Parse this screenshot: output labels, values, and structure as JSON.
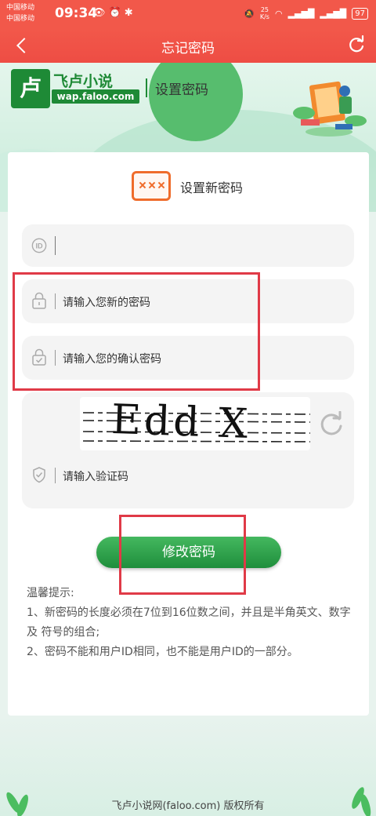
{
  "status_bar": {
    "carrier1": "中国移动",
    "carrier2": "中国移动",
    "time": "09:34",
    "net_speed_value": "25",
    "net_speed_unit": "K/s",
    "battery": "97"
  },
  "nav": {
    "title": "忘记密码"
  },
  "banner": {
    "logo_glyph": "卢",
    "logo_name": "飞卢小说",
    "logo_url": "wap.faloo.com",
    "subtitle": "设置密码"
  },
  "card": {
    "title": "设置新密码",
    "user_id_value": "",
    "new_password_placeholder": "请输入您新的密码",
    "confirm_password_placeholder": "请输入您的确认密码",
    "captcha_text": "Edd X",
    "captcha_placeholder": "请输入验证码",
    "submit_label": "修改密码"
  },
  "tips": {
    "heading": "温馨提示:",
    "line1": "1、新密码的长度必须在7位到16位数之间，并且是半角英文、数字及 符号的组合;",
    "line2": "2、密码不能和用户ID相同，也不能是用户ID的一部分。"
  },
  "footer": {
    "copyright": "飞卢小说网(faloo.com) 版权所有"
  },
  "colors": {
    "brand_red": "#f2584a",
    "brand_green": "#1e8a36",
    "button_green": "#2fa34a",
    "annotation_red": "#e03a47",
    "icon_orange": "#ef6c2b"
  }
}
